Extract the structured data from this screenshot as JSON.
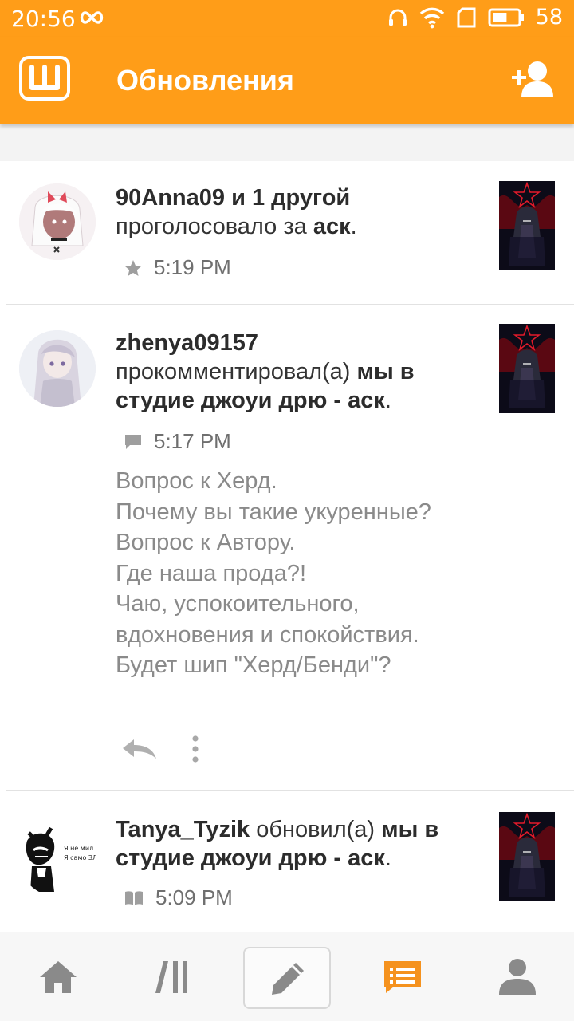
{
  "status_bar": {
    "time": "20:56",
    "battery_level": "58",
    "icons": [
      "infinity-icon",
      "headphones-icon",
      "wifi-icon",
      "sim-icon",
      "battery-icon"
    ]
  },
  "app_bar": {
    "title": "Обновления",
    "icons": [
      "wattpad-logo-icon",
      "add-user-icon"
    ]
  },
  "feed": [
    {
      "user": "90Anna09 и 1 другой",
      "action": "проголосовало за",
      "story": "аск",
      "end": ".",
      "time": "5:19 PM",
      "type_icon": "star-icon"
    },
    {
      "user": "zhenya09157",
      "action": "прокомментировал(а)",
      "story": "мы в студие джоуи дрю - аск",
      "end": ".",
      "time": "5:17 PM",
      "type_icon": "comment-icon",
      "comment": "Вопрос к Херд.\nПочему вы такие укуренные?\nВопрос к Автору.\nГде наша прода?!\nЧаю, успокоительного, вдохновения и спокойствия.\nБудет шип \"Херд/Бенди\"?"
    },
    {
      "user": "Tanya_Tyzik",
      "action": "обновил(а)",
      "story": "мы в студие джоуи дрю - аск",
      "end": ".",
      "time": "5:09 PM",
      "type_icon": "book-icon",
      "avatar_text_line1": "Я не мил",
      "avatar_text_line2": "Я само ЗЛО"
    }
  ],
  "colors": {
    "accent": "#ff9d18",
    "active_tab": "#f5921e",
    "inactive_tab": "#8a8a8a"
  },
  "bottom_nav": {
    "icons": [
      "home-icon",
      "library-icon",
      "write-icon",
      "updates-icon",
      "profile-icon"
    ],
    "active": "updates-icon"
  }
}
